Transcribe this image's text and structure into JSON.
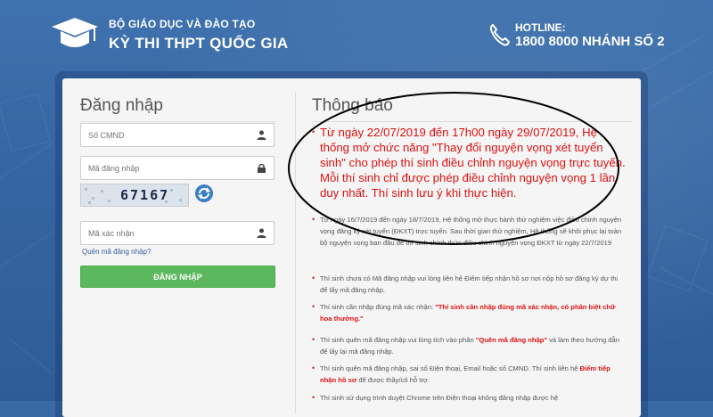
{
  "header": {
    "org": "BỘ GIÁO DỤC VÀ ĐÀO TẠO",
    "exam": "KỲ THI THPT QUỐC GIA",
    "hotline_label": "HOTLINE:",
    "hotline_number": "1800 8000 NHÁNH SỐ 2"
  },
  "login": {
    "title": "Đăng nhập",
    "cmnd_placeholder": "Số CMND",
    "password_placeholder": "Mã đăng nhập",
    "captcha_value": "67167",
    "captcha_placeholder": "Mã xác nhận",
    "forgot": "Quên mã đăng nhập?",
    "button": "ĐĂNG NHẬP"
  },
  "notice": {
    "title": "Thông báo",
    "highlight": "Từ ngày 22/07/2019 đến 17h00 ngày 29/07/2019, Hệ thống mở chức năng \"Thay đổi nguyện vọng xét tuyển sinh\" cho phép thí sinh điều chỉnh nguyện vọng trực tuyến. Mỗi thí sinh chỉ được phép điều chỉnh nguyện vọng 1 lần duy nhất. Thí sinh lưu ý khi thực hiện.",
    "item1": "Từ ngày 16/7/2019 đến ngày 18/7/2019, Hệ thống mở thực hành thử nghiệm việc điều chỉnh nguyện vọng đăng ký xét tuyển (ĐKXT) trực tuyến. Sau thời gian thử nghiệm, Hệ thống sẽ khôi phục lại toàn bộ nguyện vọng ban đầu để thí sinh chính thức điều chỉnh nguyện vọng ĐKXT từ ngày 22/7/2019",
    "item2": "Thí sinh chưa có Mã đăng nhập vui lòng liên hệ Điểm tiếp nhận hồ sơ nơi nộp hồ sơ đăng ký dự thi để lấy mã đăng nhập.",
    "item3_pre": "Thí sinh cần nhập đúng mã xác nhận: ",
    "item3_red": "\"Thí sinh cần nhập đúng mã xác nhận, có phân biệt chữ hoa thường.\"",
    "item4_pre": "Thí sinh quên mã đăng nhập vui lòng tích vào phần ",
    "item4_red": "\"Quên mã đăng nhập\"",
    "item4_post": " và làm theo hướng dẫn để lấy lại mã đăng nhập.",
    "item5_pre": "Thí sinh quên mã đăng nhập, sai số Điện thoại, Email hoặc số CMND. Thí sinh liên hệ ",
    "item5_red": "Điểm tiếp nhận hồ sơ",
    "item5_post": " để được thầy/cô hỗ trợ.",
    "item6": "Thí sinh sử dụng trình duyệt Chrome trên Điện thoại không đăng nhập được hệ"
  },
  "colors": {
    "accent_red": "#dd1111",
    "login_green": "#5cb85c",
    "header_blue": "#3a6aa6"
  }
}
